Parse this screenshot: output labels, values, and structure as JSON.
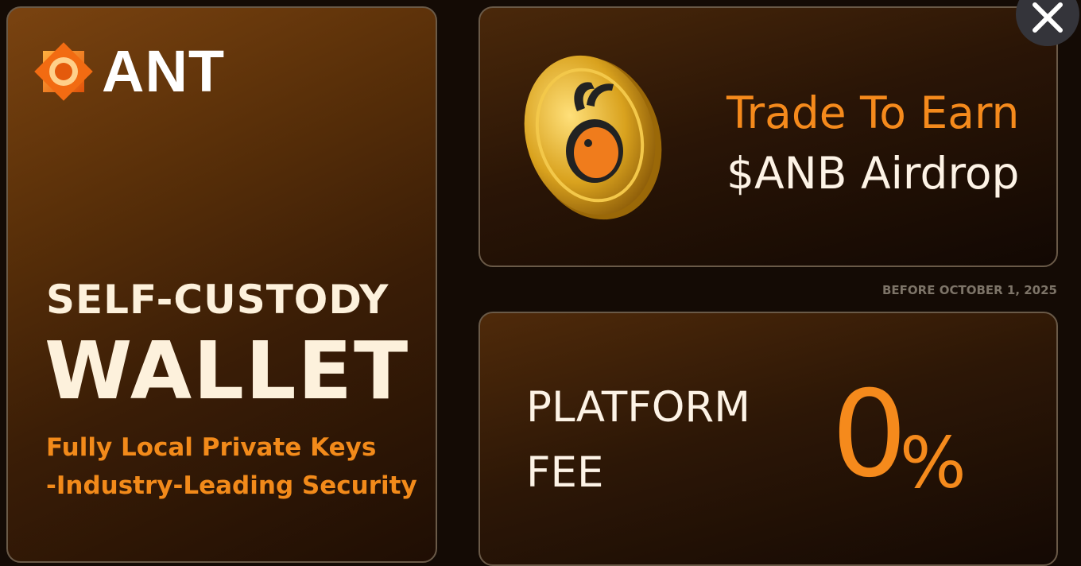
{
  "brand": {
    "name": "ANT"
  },
  "left_card": {
    "headline_1": "SELF-CUSTODY",
    "headline_2": "WALLET",
    "feature_1": "Fully Local Private Keys",
    "feature_2": "-Industry-Leading Security"
  },
  "top_card": {
    "title": "Trade To Earn",
    "subtitle": "$ANB Airdrop",
    "coin_icon": "ant-coin-icon"
  },
  "deadline_note": "BEFORE OCTOBER 1, 2025",
  "bottom_card": {
    "label_1": "PLATFORM",
    "label_2": "FEE",
    "value": "0",
    "unit": "%"
  },
  "close_icon": "close-icon",
  "colors": {
    "accent": "#f58a1c",
    "cream": "#fdf1dc",
    "border": "#6a5a48",
    "close_bg": "#34343a"
  }
}
